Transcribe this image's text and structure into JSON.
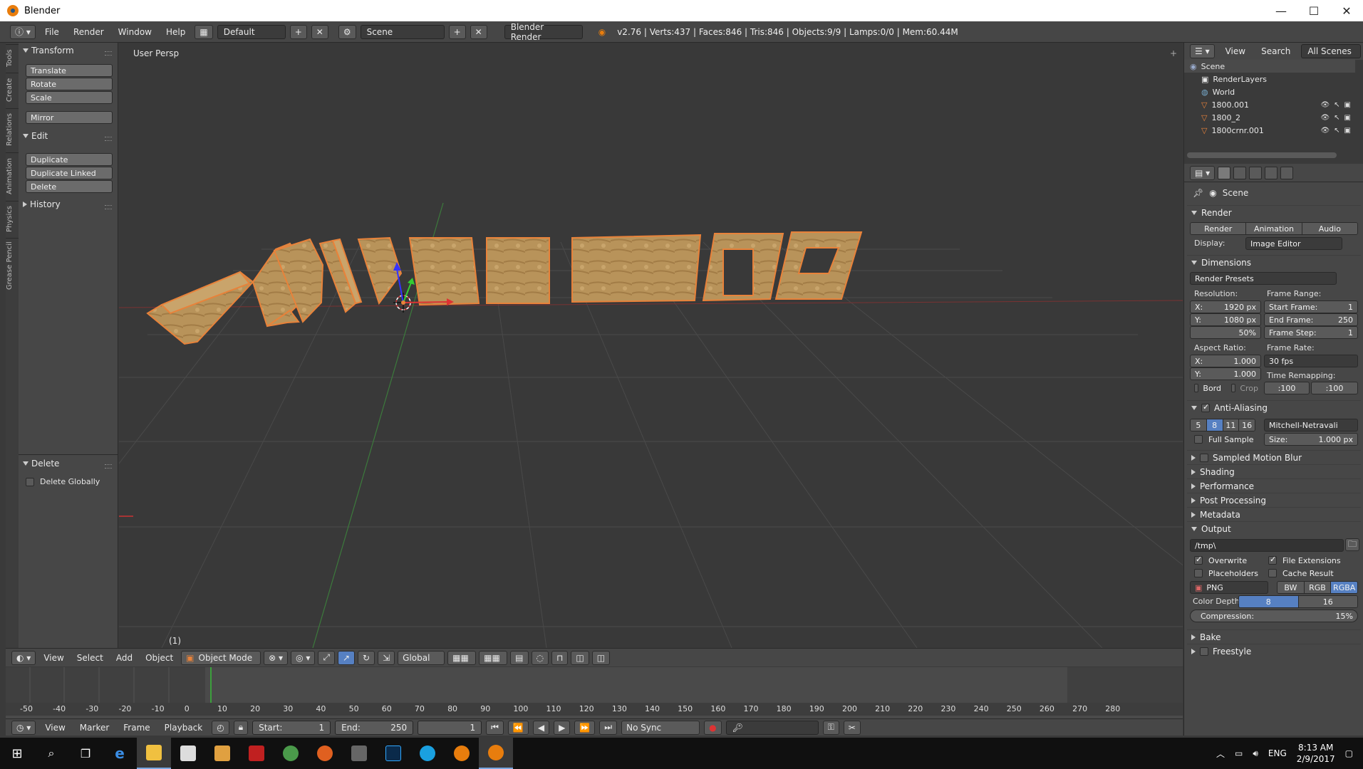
{
  "window": {
    "title": "Blender",
    "minimize": "—",
    "maximize": "☐",
    "close": "✕"
  },
  "info_header": {
    "menus": [
      "File",
      "Render",
      "Window",
      "Help"
    ],
    "layout": "Default",
    "scene": "Scene",
    "engine": "Blender Render",
    "stats": "v2.76 | Verts:437 | Faces:846 | Tris:846 | Objects:9/9 | Lamps:0/0 | Mem:60.44M"
  },
  "tool_tabs": [
    "Tools",
    "Create",
    "Relations",
    "Animation",
    "Physics",
    "Grease Pencil"
  ],
  "toolshelf": {
    "transform": {
      "title": "Transform",
      "buttons": [
        "Translate",
        "Rotate",
        "Scale",
        "Mirror"
      ]
    },
    "edit": {
      "title": "Edit",
      "buttons": [
        "Duplicate",
        "Duplicate Linked",
        "Delete"
      ]
    },
    "history": {
      "title": "History"
    },
    "operator": {
      "title": "Delete",
      "option": "Delete Globally"
    }
  },
  "viewport": {
    "view_label": "User Persp",
    "frame_label": "(1)"
  },
  "view3d_header": {
    "menus": [
      "View",
      "Select",
      "Add",
      "Object"
    ],
    "mode": "Object Mode",
    "orientation": "Global"
  },
  "timeline": {
    "ticks": [
      "-50",
      "-40",
      "-30",
      "-20",
      "-10",
      "0",
      "10",
      "20",
      "30",
      "40",
      "50",
      "60",
      "70",
      "80",
      "90",
      "100",
      "110",
      "120",
      "130",
      "140",
      "150",
      "160",
      "170",
      "180",
      "190",
      "200",
      "210",
      "220",
      "230",
      "240",
      "250",
      "260",
      "270",
      "280"
    ],
    "current_frame": 1,
    "menus": [
      "View",
      "Marker",
      "Frame",
      "Playback"
    ],
    "start_label": "Start:",
    "start": "1",
    "end_label": "End:",
    "end": "250",
    "frame": "1",
    "sync": "No Sync"
  },
  "outliner": {
    "menus": [
      "View",
      "Search"
    ],
    "filter": "All Scenes",
    "rows": [
      "Scene",
      "RenderLayers",
      "World",
      "1800.001",
      "1800_2",
      "1800crnr.001"
    ]
  },
  "properties": {
    "context": "Scene",
    "render": {
      "title": "Render",
      "buttons": [
        "Render",
        "Animation",
        "Audio"
      ],
      "display_label": "Display:",
      "display": "Image Editor"
    },
    "dimensions": {
      "title": "Dimensions",
      "presets": "Render Presets",
      "resolution_label": "Resolution:",
      "res_x_label": "X:",
      "res_x": "1920 px",
      "res_y_label": "Y:",
      "res_y": "1080 px",
      "res_pct": "50%",
      "frame_range_label": "Frame Range:",
      "start_frame_label": "Start Frame:",
      "start_frame": "1",
      "end_frame_label": "End Frame:",
      "end_frame": "250",
      "frame_step_label": "Frame Step:",
      "frame_step": "1",
      "aspect_label": "Aspect Ratio:",
      "asp_x": "1.000",
      "asp_y": "1.000",
      "frame_rate_label": "Frame Rate:",
      "frame_rate": "30 fps",
      "remap_label": "Time Remapping:",
      "remap_old": ":100",
      "remap_new": ":100",
      "bord": "Bord",
      "crop": "Crop"
    },
    "anti_aliasing": {
      "title": "Anti-Aliasing",
      "samples": [
        "5",
        "8",
        "11",
        "16"
      ],
      "selected_sample": "8",
      "filter": "Mitchell-Netravali",
      "full_sample": "Full Sample",
      "size_label": "Size:",
      "size": "1.000 px"
    },
    "collapsed": [
      "Sampled Motion Blur",
      "Shading",
      "Performance",
      "Post Processing",
      "Metadata"
    ],
    "output": {
      "title": "Output",
      "path": "/tmp\\",
      "overwrite": "Overwrite",
      "file_extensions": "File Extensions",
      "placeholders": "Placeholders",
      "cache_result": "Cache Result",
      "format": "PNG",
      "color_modes": [
        "BW",
        "RGB",
        "RGBA"
      ],
      "color_mode_selected": "RGBA",
      "depth_label": "Color Depth:",
      "depths": [
        "8",
        "16"
      ],
      "compression_label": "Compression:",
      "compression": "15%"
    },
    "bottom_sections": [
      "Bake",
      "Freestyle"
    ]
  },
  "taskbar": {
    "lang": "ENG",
    "time": "8:13 AM",
    "date": "2/9/2017"
  },
  "colors": {
    "selection_outline": "#e8823a",
    "accent_blue": "#5680c2",
    "x_axis": "#c83232",
    "y_axis": "#3ca03c"
  }
}
